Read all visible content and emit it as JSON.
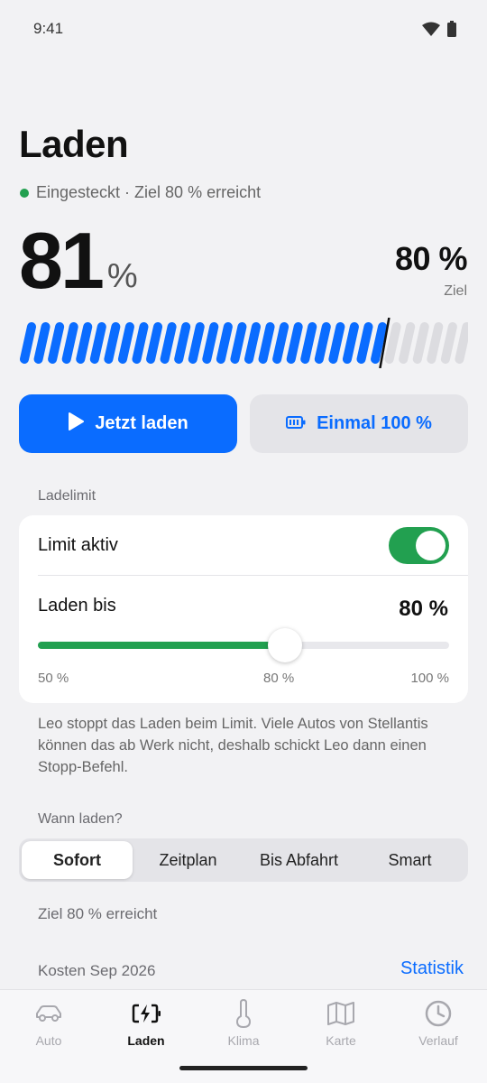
{
  "status_bar": {
    "time": "9:41",
    "icons": [
      "wifi-icon",
      "battery-icon"
    ]
  },
  "header": {
    "title": "Laden",
    "status_text": "Eingesteckt · Ziel 80 % erreicht",
    "status_color": "#22a050"
  },
  "charge": {
    "soc_value": "81",
    "soc_unit": "%",
    "soc_level": 0.81,
    "target_value": "80 %",
    "target_label": "Ziel",
    "target_level": 0.8
  },
  "actions": {
    "primary_label": "Jetzt laden",
    "secondary_label": "Einmal 100 %"
  },
  "limit": {
    "section_label": "Ladelimit",
    "active_label": "Limit aktiv",
    "toggle_on": true,
    "until_label": "Laden bis",
    "until_value": "80 %",
    "slider_level": 0.6,
    "tick_min": "50 %",
    "tick_mid": "80 %",
    "tick_max": "100 %",
    "info": "Leo stoppt das Laden beim Limit. Viele Autos von Stellantis können das ab Werk nicht, deshalb schickt Leo dann einen Stopp-Befehl."
  },
  "schedule": {
    "section_label": "Wann laden?",
    "options": [
      "Sofort",
      "Zeitplan",
      "Bis Abfahrt",
      "Smart"
    ],
    "selected": "Sofort",
    "status": "Ziel 80 % erreicht"
  },
  "costs": {
    "label": "Kosten Sep 2026",
    "link": "Statistik"
  },
  "nav": {
    "items": [
      {
        "label": "Auto",
        "icon": "car-icon"
      },
      {
        "label": "Laden",
        "icon": "charging-icon"
      },
      {
        "label": "Klima",
        "icon": "thermometer-icon"
      },
      {
        "label": "Karte",
        "icon": "map-icon"
      },
      {
        "label": "Verlauf",
        "icon": "clock-icon"
      }
    ],
    "active": "Laden"
  },
  "colors": {
    "accent": "#0a6cff",
    "success": "#22a050"
  }
}
